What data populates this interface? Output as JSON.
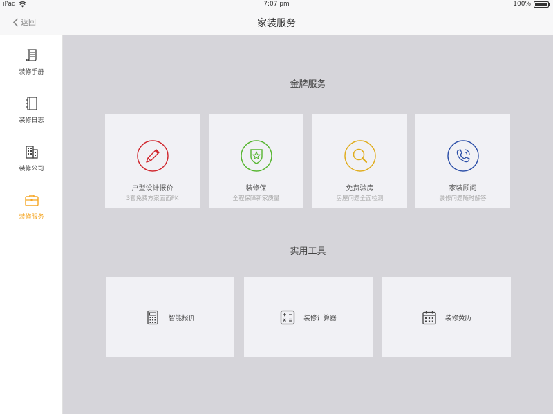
{
  "statusbar": {
    "device": "iPad",
    "time": "7:07 pm",
    "battery": "100%"
  },
  "navbar": {
    "back_label": "返回",
    "title": "家装服务"
  },
  "sidebar": {
    "items": [
      {
        "label": "装修手册",
        "icon": "manual-icon"
      },
      {
        "label": "装修日志",
        "icon": "diary-icon"
      },
      {
        "label": "装修公司",
        "icon": "building-icon"
      },
      {
        "label": "装修服务",
        "icon": "briefcase-icon",
        "active": true
      }
    ]
  },
  "gold_services": {
    "title": "金牌服务",
    "cards": [
      {
        "title": "户型设计报价",
        "subtitle": "3套免费方案面面PK",
        "icon": "pencil-icon",
        "color": "#d0262d"
      },
      {
        "title": "装修保",
        "subtitle": "全程保障新家质量",
        "icon": "shield-star-icon",
        "color": "#55b52f"
      },
      {
        "title": "免费验房",
        "subtitle": "房屋问题全面检测",
        "icon": "magnifier-icon",
        "color": "#e0ac1b"
      },
      {
        "title": "家装顾问",
        "subtitle": "装修问题随时解答",
        "icon": "phone-icon",
        "color": "#2c4fa8"
      }
    ]
  },
  "tools": {
    "title": "实用工具",
    "items": [
      {
        "label": "智能报价",
        "icon": "calculator-icon"
      },
      {
        "label": "装修计算器",
        "icon": "math-symbols-icon"
      },
      {
        "label": "装修黄历",
        "icon": "calendar-icon"
      }
    ]
  },
  "colors": {
    "accent": "#f5a623",
    "background": "#d6d5da",
    "card": "#f1f1f5"
  }
}
